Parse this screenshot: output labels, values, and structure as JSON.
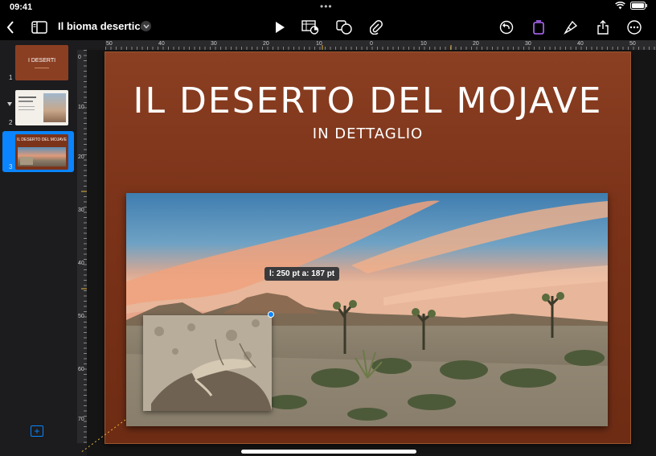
{
  "status": {
    "time": "09:41",
    "dots": "•••"
  },
  "toolbar": {
    "doc_title": "Il bioma desertico",
    "icons": [
      "back-chevron-icon",
      "sidebar-icon",
      "play-icon",
      "table-chart-icon",
      "shapes-icon",
      "paperclip-icon",
      "undo-icon",
      "document-icon",
      "paintbrush-icon",
      "share-icon",
      "more-icon"
    ],
    "accent": "#b26bff"
  },
  "navigator": {
    "slides": [
      {
        "number": "1",
        "title": "I DESERTI",
        "selected": false
      },
      {
        "number": "2",
        "title": "",
        "selected": false
      },
      {
        "number": "3",
        "title": "IL DESERTO DEL MOJAVE",
        "selected": true
      }
    ]
  },
  "ruler": {
    "h_labels": [
      "50",
      "40",
      "30",
      "20",
      "10",
      "0",
      "10",
      "20",
      "30",
      "40",
      "50"
    ],
    "v_labels": [
      "0",
      "10",
      "20",
      "30",
      "40",
      "50",
      "60",
      "70"
    ]
  },
  "slide": {
    "title": "IL DESERTO DEL MOJAVE",
    "subtitle": "IN DETTAGLIO",
    "background_color": "#7b3319"
  },
  "selection": {
    "size_label": "l: 250 pt  a: 187 pt",
    "handle_color": "#0a84ff"
  }
}
